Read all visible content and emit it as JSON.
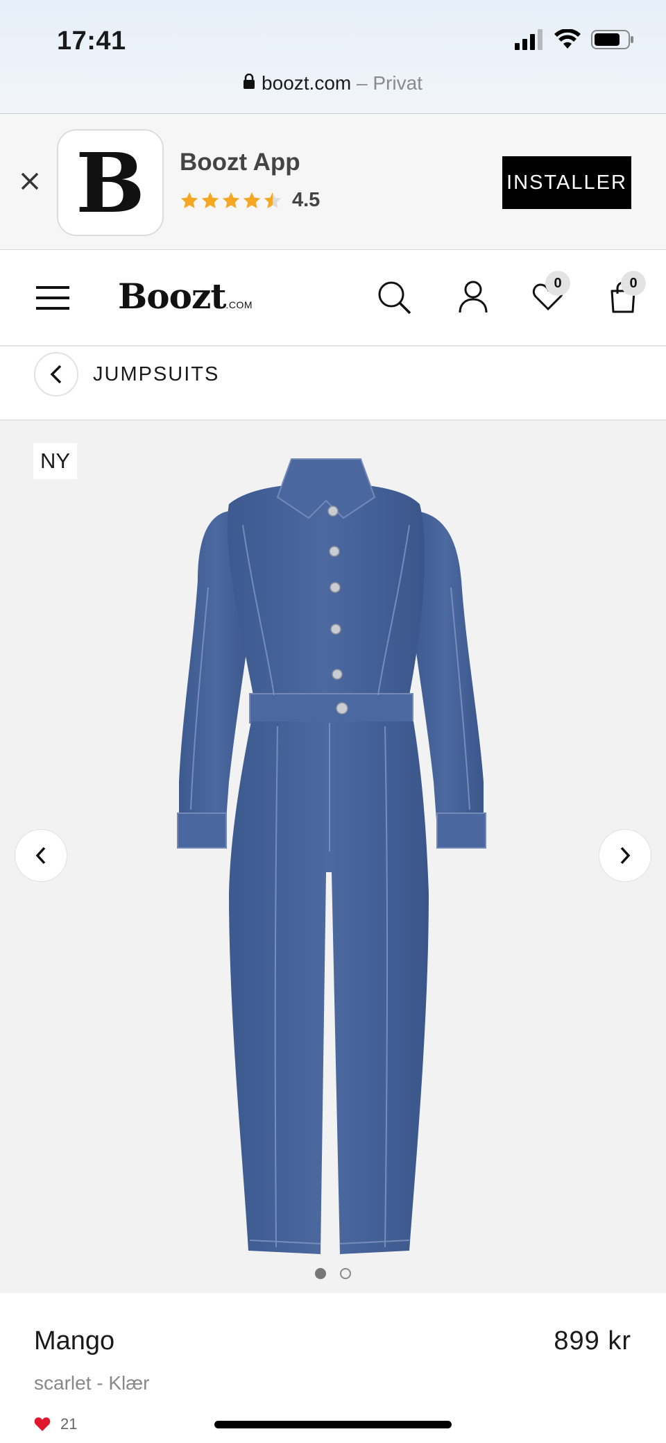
{
  "status_bar": {
    "time": "17:41"
  },
  "url_bar": {
    "domain": "boozt.com",
    "mode": "– Privat"
  },
  "app_banner": {
    "icon_letter": "B",
    "app_name": "Boozt App",
    "rating": "4.5",
    "install_label": "INSTALLER",
    "star_color": "#f5a623"
  },
  "header": {
    "logo": "Boozt",
    "logo_suffix": ".COM",
    "wishlist_count": "0",
    "cart_count": "0"
  },
  "breadcrumb": {
    "label": "JUMPSUITS"
  },
  "gallery": {
    "badge": "NY",
    "image_count": 2,
    "active_index": 0
  },
  "product": {
    "brand": "Mango",
    "price": "899 kr",
    "subtitle": "scarlet - Klær",
    "likes": "21",
    "heart_color": "#e0182d"
  }
}
